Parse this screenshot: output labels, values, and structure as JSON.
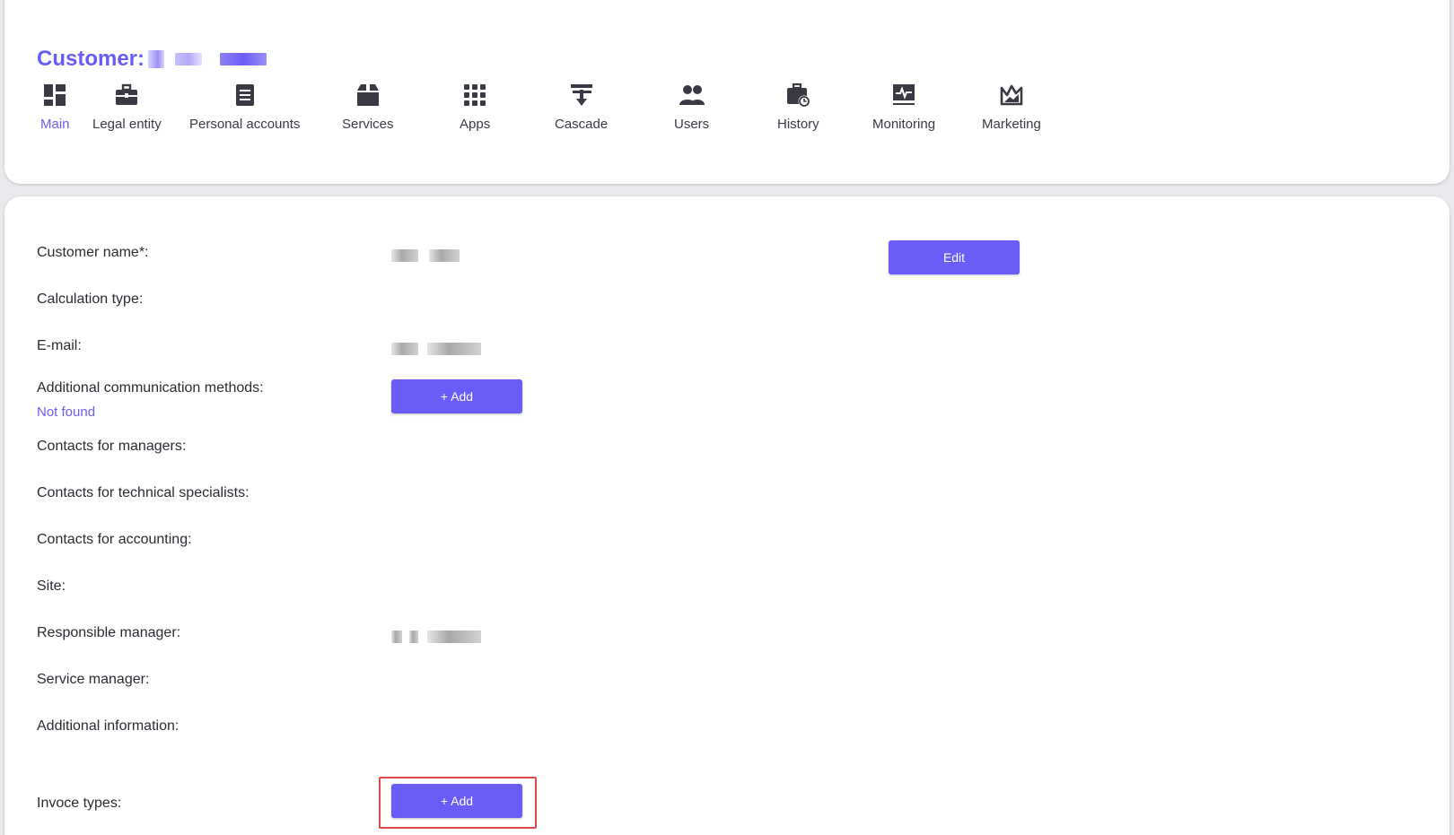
{
  "header": {
    "title": "Customer:"
  },
  "nav": {
    "items": [
      {
        "label": "Main",
        "icon": "dashboard-icon",
        "active": true
      },
      {
        "label": "Legal entity",
        "icon": "briefcase-icon"
      },
      {
        "label": "Personal accounts",
        "icon": "document-icon"
      },
      {
        "label": "Services",
        "icon": "box-icon"
      },
      {
        "label": "Apps",
        "icon": "grid-icon"
      },
      {
        "label": "Cascade",
        "icon": "cascade-icon"
      },
      {
        "label": "Users",
        "icon": "users-icon"
      },
      {
        "label": "History",
        "icon": "history-icon"
      },
      {
        "label": "Monitoring",
        "icon": "monitor-icon"
      },
      {
        "label": "Marketing",
        "icon": "marketing-icon"
      }
    ]
  },
  "fields": {
    "customer_name": "Customer name*:",
    "calculation_type": "Calculation type:",
    "email": "E-mail:",
    "additional_comm": "Additional communication methods:",
    "not_found": "Not found",
    "contacts_managers": "Contacts for managers:",
    "contacts_technical": "Contacts for technical specialists:",
    "contacts_accounting": "Contacts for accounting:",
    "site": "Site:",
    "responsible_manager": "Responsible manager:",
    "service_manager": "Service manager:",
    "additional_info": "Additional information:",
    "invoice_types": "Invoce types:"
  },
  "buttons": {
    "edit": "Edit",
    "add_comm": "+ Add",
    "add_invoice": "+ Add"
  },
  "colors": {
    "accent": "#6a5cf6",
    "highlight": "#e04848",
    "background": "#e9e9ee"
  }
}
